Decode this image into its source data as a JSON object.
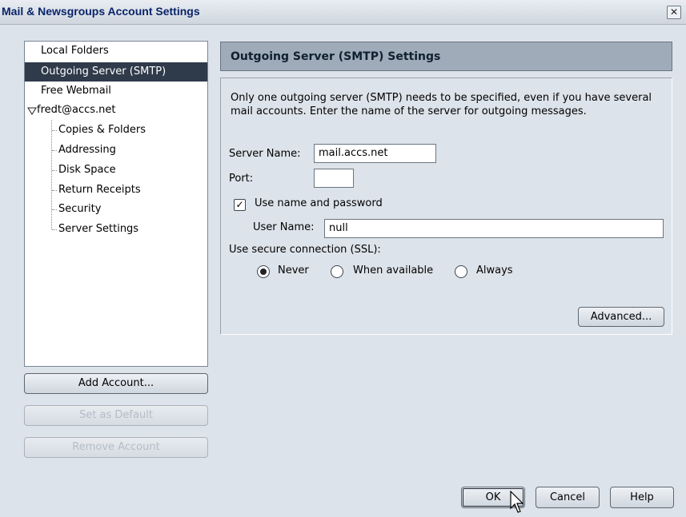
{
  "window": {
    "title": "Mail & Newsgroups Account Settings",
    "close_icon": "close-icon"
  },
  "tree": {
    "items": [
      {
        "label": "Local Folders"
      },
      {
        "label": "Outgoing Server (SMTP)",
        "selected": true
      },
      {
        "label": "Free Webmail"
      },
      {
        "label": "fredt@accs.net",
        "expanded": true
      },
      {
        "label": "Copies & Folders"
      },
      {
        "label": "Addressing"
      },
      {
        "label": "Disk Space"
      },
      {
        "label": "Return Receipts"
      },
      {
        "label": "Security"
      },
      {
        "label": "Server Settings"
      }
    ]
  },
  "account_buttons": {
    "add": "Add Account...",
    "set_default": "Set as Default",
    "remove": "Remove Account"
  },
  "panel": {
    "title": "Outgoing Server (SMTP) Settings",
    "description": "Only one outgoing server (SMTP) needs to be specified, even if you have several mail accounts. Enter the name of the server for outgoing messages.",
    "server_name_label": "Server Name:",
    "server_name_value": "mail.accs.net",
    "port_label": "Port:",
    "port_value": "",
    "use_name_password_label": "Use name and password",
    "use_name_password_checked": true,
    "user_name_label": "User Name:",
    "user_name_value": "null",
    "ssl_label": "Use secure connection (SSL):",
    "ssl_options": [
      {
        "label": "Never",
        "checked": true
      },
      {
        "label": "When available",
        "checked": false
      },
      {
        "label": "Always",
        "checked": false
      }
    ],
    "advanced_button": "Advanced..."
  },
  "dialog_buttons": {
    "ok": "OK",
    "cancel": "Cancel",
    "help": "Help"
  }
}
